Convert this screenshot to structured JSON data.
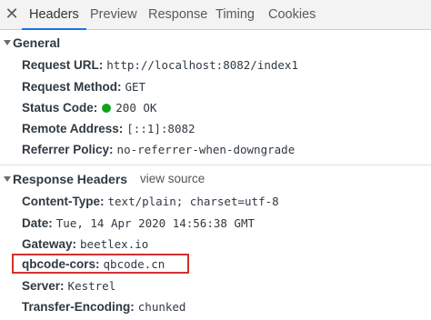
{
  "tabs": {
    "close_glyph": "✕",
    "items": [
      "Headers",
      "Preview",
      "Response",
      "Timing",
      "Cookies"
    ],
    "active": "Headers"
  },
  "general": {
    "title": "General",
    "request_url": {
      "key": "Request URL:",
      "value": "http://localhost:8082/index1"
    },
    "request_method": {
      "key": "Request Method:",
      "value": "GET"
    },
    "status_code": {
      "key": "Status Code:",
      "value": "200 OK",
      "indicator_color": "#0ea31c"
    },
    "remote_address": {
      "key": "Remote Address:",
      "value": "[::1]:8082"
    },
    "referrer_policy": {
      "key": "Referrer Policy:",
      "value": "no-referrer-when-downgrade"
    }
  },
  "response_headers": {
    "title": "Response Headers",
    "view_source": "view source",
    "content_type": {
      "key": "Content-Type:",
      "value": "text/plain; charset=utf-8"
    },
    "date": {
      "key": "Date:",
      "value": "Tue, 14 Apr 2020 14:56:38 GMT"
    },
    "gateway": {
      "key": "Gateway:",
      "value": "beetlex.io"
    },
    "qbcode_cors": {
      "key": "qbcode-cors:",
      "value": "qbcode.cn"
    },
    "server": {
      "key": "Server:",
      "value": "Kestrel"
    },
    "transfer_encoding": {
      "key": "Transfer-Encoding:",
      "value": "chunked"
    }
  },
  "colors": {
    "accent": "#1a73e8",
    "highlight_border": "#d32f2f"
  }
}
